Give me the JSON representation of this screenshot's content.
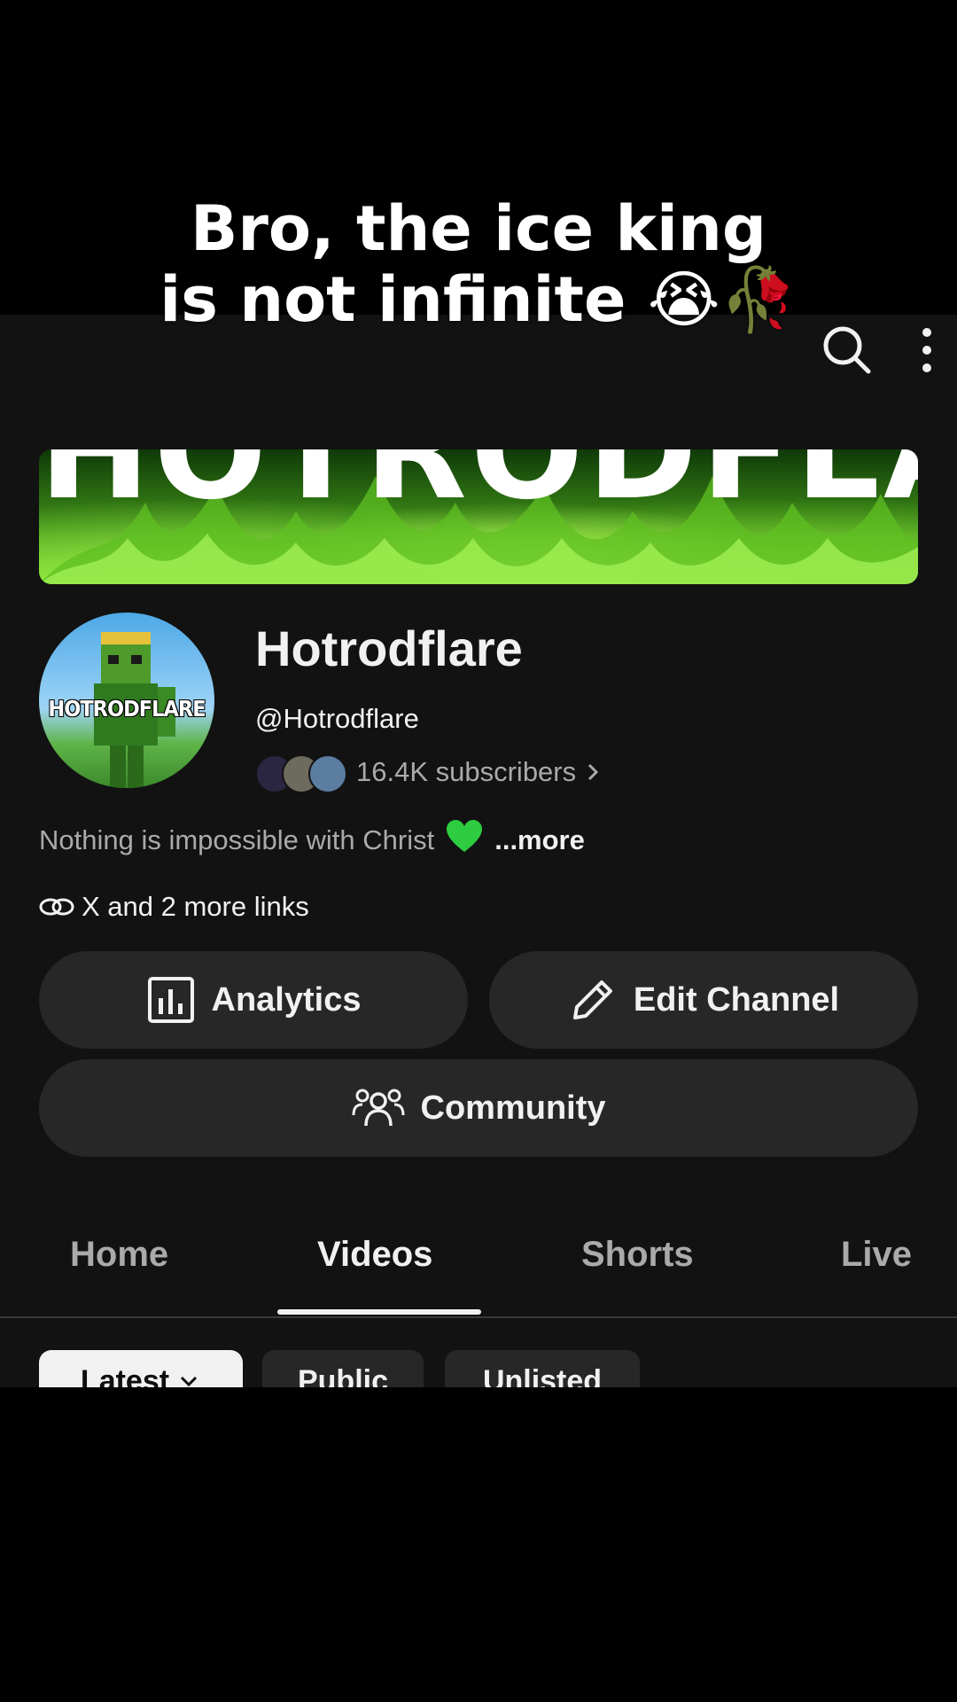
{
  "overlay_caption": {
    "line1": "Bro, the ice king",
    "line2": "is not infinite 😭🥀"
  },
  "topbar": {
    "search_icon": "search-icon",
    "more_icon": "more-vert-icon"
  },
  "banner": {
    "text": "HOTRODFLARE"
  },
  "avatar": {
    "label": "HOTRODFLARE"
  },
  "channel": {
    "name": "Hotrodflare",
    "handle": "@Hotrodflare",
    "subscribers": "16.4K subscribers",
    "bio": "Nothing is impossible with Christ",
    "bio_more": "...more",
    "links_text": "X and 2 more links"
  },
  "buttons": {
    "analytics": "Analytics",
    "edit_channel": "Edit Channel",
    "community": "Community"
  },
  "tabs": [
    {
      "label": "Home",
      "active": false
    },
    {
      "label": "Videos",
      "active": true
    },
    {
      "label": "Shorts",
      "active": false
    },
    {
      "label": "Live",
      "active": false
    }
  ],
  "chips": [
    {
      "label": "Latest",
      "selected": true
    },
    {
      "label": "Public",
      "selected": false
    },
    {
      "label": "Unlisted",
      "selected": false
    }
  ],
  "colors": {
    "background": "#121212",
    "button_bg": "#272727",
    "text_primary": "#f1f1f1",
    "text_secondary": "#aaaaaa",
    "banner_green": "#6ccf2a",
    "heart_green": "#2ecc40"
  }
}
